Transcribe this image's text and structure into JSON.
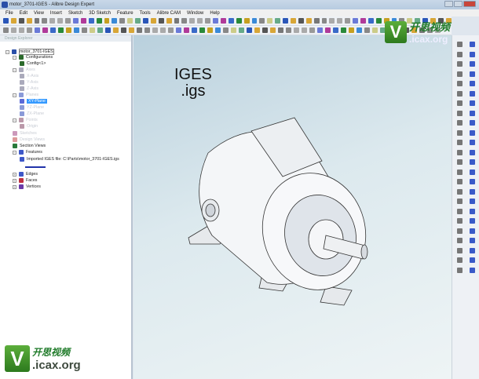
{
  "window": {
    "title": "motor_3701-IGES - Alibre Design Expert"
  },
  "menu": [
    "File",
    "Edit",
    "View",
    "Insert",
    "Sketch",
    "3D Sketch",
    "Feature",
    "Tools",
    "Alibre CAM",
    "Window",
    "Help"
  ],
  "explorer": {
    "header": "Design Explorer",
    "nodes": [
      {
        "label": "motor_3701-IGES",
        "faded": false
      },
      {
        "label": "Configurations",
        "faded": false
      },
      {
        "label": "Config<1>",
        "faded": false
      },
      {
        "label": "Axes",
        "faded": true
      },
      {
        "label": "X-Axis",
        "faded": true
      },
      {
        "label": "Y-Axis",
        "faded": true
      },
      {
        "label": "Z-Axis",
        "faded": true
      },
      {
        "label": "Planes",
        "faded": true
      },
      {
        "label": "XY-Plane",
        "faded": false
      },
      {
        "label": "YZ-Plane",
        "faded": true
      },
      {
        "label": "ZX-Plane",
        "faded": true
      },
      {
        "label": "Points",
        "faded": true
      },
      {
        "label": "Origin",
        "faded": true
      },
      {
        "label": "Sketches",
        "faded": true
      },
      {
        "label": "Design Views",
        "faded": true
      },
      {
        "label": "Section Views",
        "faded": false
      },
      {
        "label": "Features",
        "faded": false
      },
      {
        "label": "Imported IGES file: C:\\Parts\\motor_3701-IGES.igs",
        "faded": false
      },
      {
        "label": "Edges",
        "faded": false
      },
      {
        "label": "Faces",
        "faded": false
      },
      {
        "label": "Vertices",
        "faded": false
      }
    ]
  },
  "viewport": {
    "line1": "IGES",
    "line2": ".igs"
  },
  "watermark": {
    "logo": "V",
    "cn": "开思视频",
    "site": ".icax.org"
  }
}
